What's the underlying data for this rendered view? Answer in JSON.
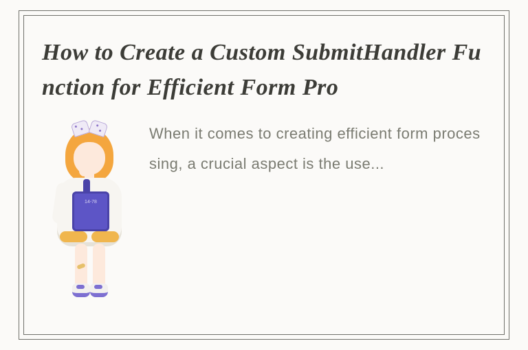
{
  "card": {
    "title": "How to Create a Custom SubmitHandler Function for Efficient Form Pro",
    "body": "When it comes to creating efficient form processing, a crucial aspect is the use...",
    "bag_label": "14-78"
  }
}
